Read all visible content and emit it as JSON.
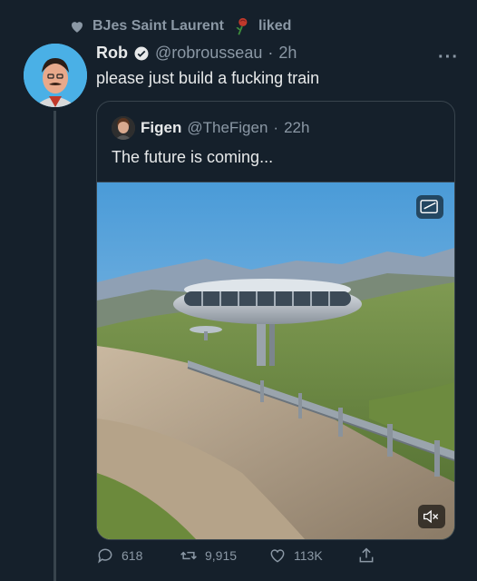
{
  "social_context": {
    "user": "BJes Saint Laurent",
    "action": "liked",
    "icon": "heart-icon"
  },
  "tweet": {
    "author_name": "Rob",
    "handle": "@robrousseau",
    "separator": "·",
    "time": "2h",
    "text": "please just build a fucking train",
    "verified": true
  },
  "quote": {
    "author_name": "Figen",
    "handle": "@TheFigen",
    "separator": "·",
    "time": "22h",
    "text": "The future is coming..."
  },
  "actions": {
    "replies": "618",
    "retweets": "9,915",
    "likes": "113K"
  },
  "colors": {
    "background": "#15202b",
    "secondary_text": "#8b98a5",
    "border": "#38444d",
    "verified": "#1d9bf0"
  }
}
